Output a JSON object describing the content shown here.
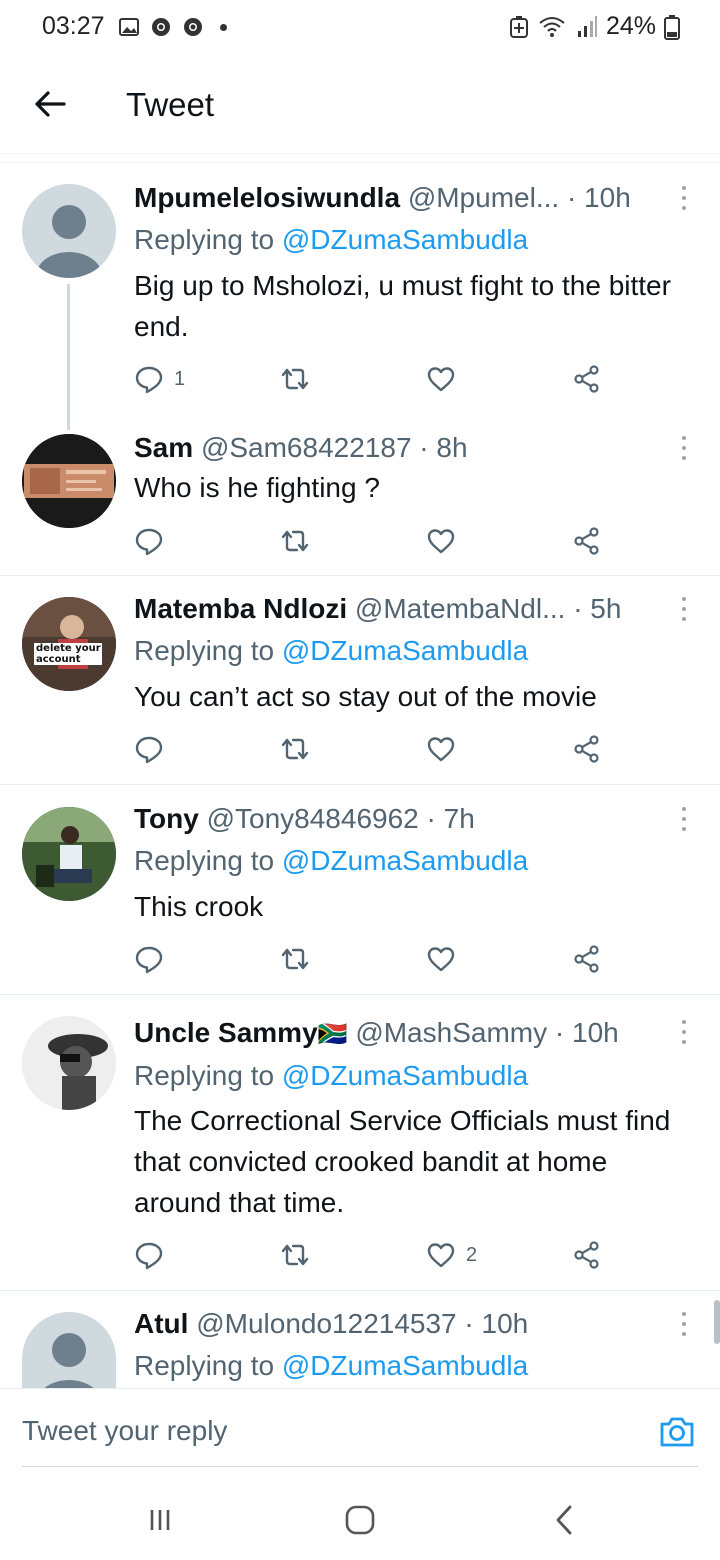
{
  "status_bar": {
    "time": "03:27",
    "battery": "24%",
    "left_icons": [
      "gallery-icon",
      "chrome-icon",
      "chrome-icon",
      "dot"
    ],
    "right_icons": [
      "battery-saver-icon",
      "wifi-icon",
      "signal-icon",
      "battery-icon"
    ]
  },
  "header": {
    "title": "Tweet",
    "back_icon": "arrow-left-icon"
  },
  "tweets": [
    {
      "name": "Mpumelelosiwundla",
      "handle": "@Mpumel...",
      "time": "· 10h",
      "replying_prefix": "Replying to ",
      "replying_to": "@DZumaSambudla",
      "body": "Big up to Msholozi, u must fight to the bitter end.",
      "reply_count": "1",
      "retweet_count": "",
      "like_count": ""
    },
    {
      "name": "Sam",
      "handle": "@Sam68422187",
      "time": "· 8h",
      "body": "Who is he fighting ?",
      "reply_count": "",
      "retweet_count": "",
      "like_count": ""
    },
    {
      "name": "Matemba Ndlozi",
      "handle": "@MatembaNdl...",
      "time": "· 5h",
      "replying_prefix": "Replying to ",
      "replying_to": "@DZumaSambudla",
      "body": "You can’t act so stay out of the movie",
      "avatar_sign_text": "delete your account",
      "reply_count": "",
      "retweet_count": "",
      "like_count": ""
    },
    {
      "name": "Tony",
      "handle": "@Tony84846962",
      "time": "· 7h",
      "replying_prefix": "Replying to ",
      "replying_to": "@DZumaSambudla",
      "body": "This crook",
      "reply_count": "",
      "retweet_count": "",
      "like_count": ""
    },
    {
      "name": "Uncle Sammy",
      "flag": "🇿🇦",
      "handle": "@MashSammy",
      "time": "· 10h",
      "replying_prefix": "Replying to ",
      "replying_to": "@DZumaSambudla",
      "body": "The Correctional Service Officials must find that convicted crooked bandit at home around that time.",
      "reply_count": "",
      "retweet_count": "",
      "like_count": "2"
    },
    {
      "name": "Atul",
      "handle": "@Mulondo12214537",
      "time": "· 10h",
      "replying_prefix": "Replying to ",
      "replying_to": "@DZumaSambudla"
    }
  ],
  "reply_bar": {
    "placeholder": "Tweet your reply",
    "camera_icon": "camera-icon"
  },
  "nav_bar": {
    "icons": [
      "recent-apps-icon",
      "home-icon",
      "back-icon"
    ]
  },
  "colors": {
    "link": "#1d9bf0",
    "secondary_text": "#536471",
    "primary_text": "#0f1419"
  }
}
